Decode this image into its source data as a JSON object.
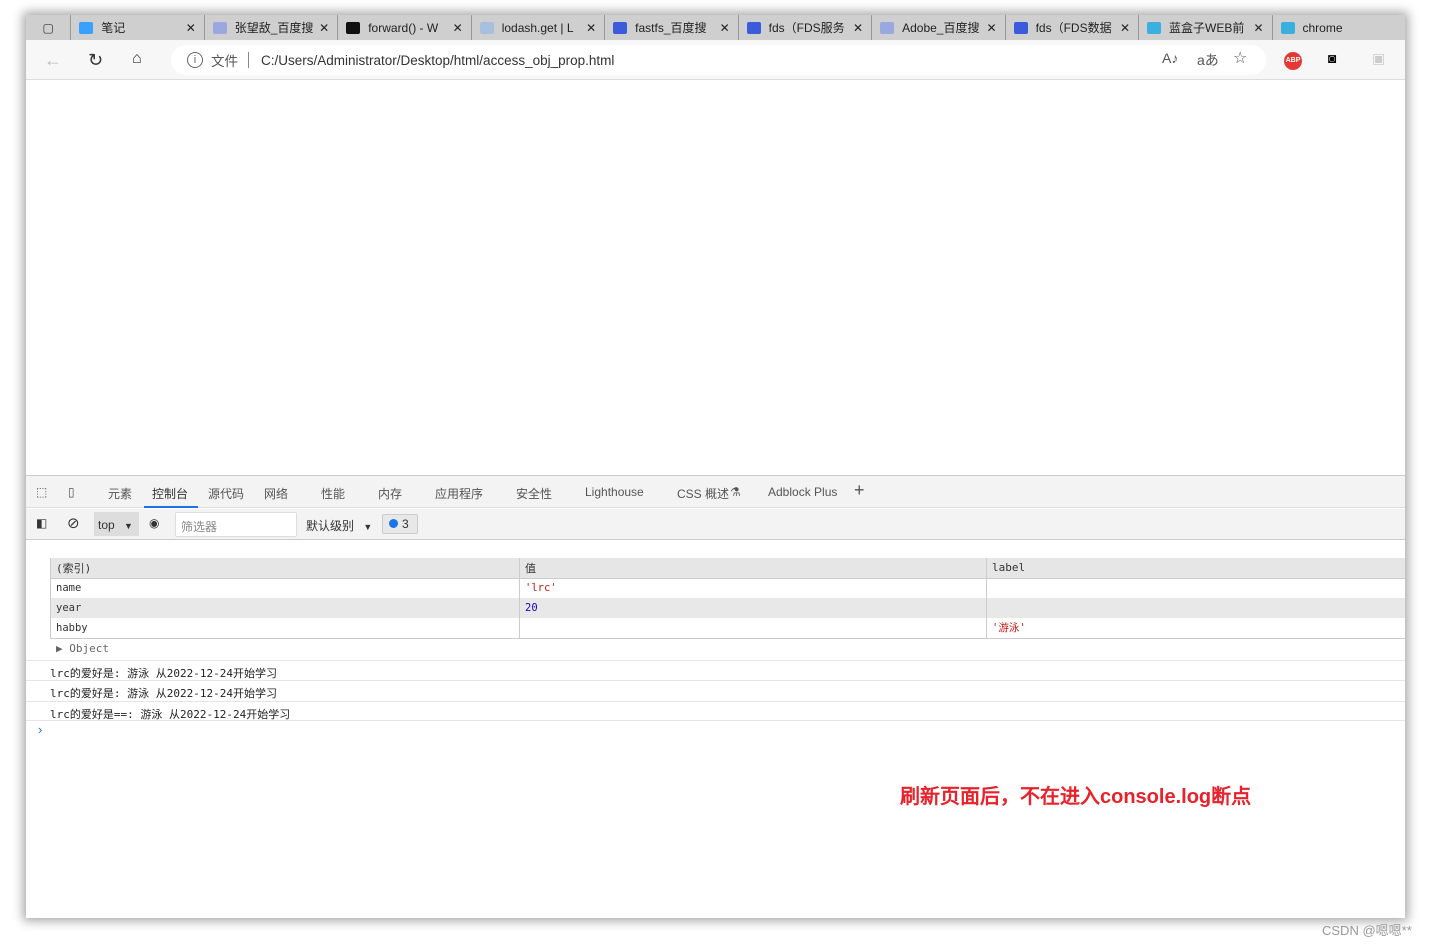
{
  "browser": {
    "tabs": [
      "笔记",
      "张望敌_百度搜",
      "forward() - W",
      "lodash.get | L",
      "fastfs_百度搜",
      "fds（FDS服务",
      "Adobe_百度搜",
      "fds（FDS数据",
      "蓝盒子WEB前",
      "chrome"
    ],
    "file_label": "文件",
    "url": "C:/Users/Administrator/Desktop/html/access_obj_prop.html",
    "abp_label": "ABP"
  },
  "devtools": {
    "tabs": [
      "元素",
      "控制台",
      "源代码",
      "网络",
      "性能",
      "内存",
      "应用程序",
      "安全性",
      "Lighthouse",
      "CSS 概述",
      "Adblock Plus"
    ],
    "active_tab": "控制台",
    "context": "top",
    "filter_placeholder": "筛选器",
    "level": "默认级别",
    "message_count": "3"
  },
  "console": {
    "table": {
      "headers": [
        "(索引)",
        "值",
        "label"
      ],
      "rows": [
        {
          "index": "name",
          "value": "'lrc'",
          "label": ""
        },
        {
          "index": "year",
          "value": "20",
          "label": ""
        },
        {
          "index": "habby",
          "value": "",
          "label": "'游泳'"
        }
      ]
    },
    "object_label": "Object",
    "logs": [
      "lrc的爱好是: 游泳 从2022-12-24开始学习",
      "lrc的爱好是: 游泳 从2022-12-24开始学习",
      "lrc的爱好是==: 游泳 从2022-12-24开始学习"
    ]
  },
  "annotation": "刷新页面后，不在进入console.log断点",
  "watermark": "CSDN @嗯嗯**"
}
